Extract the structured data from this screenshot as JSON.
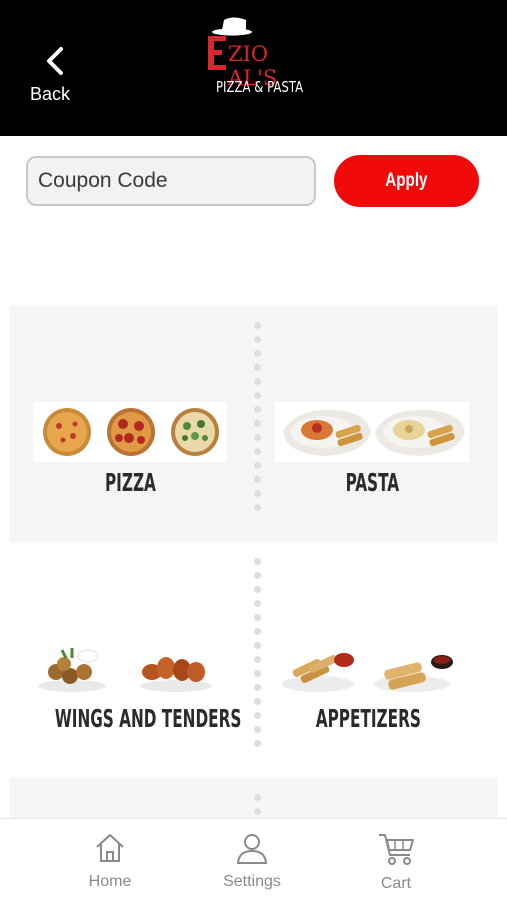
{
  "header": {
    "back_label": "Back",
    "logo": {
      "name": "ZIO AL'S",
      "initial": "E",
      "subtitle": "PIZZA & PASTA"
    }
  },
  "coupon": {
    "placeholder": "Coupon Code",
    "value": "",
    "apply_label": "Apply"
  },
  "categories": [
    {
      "label": "PIZZA"
    },
    {
      "label": "PASTA"
    },
    {
      "label": "WINGS AND TENDERS"
    },
    {
      "label": "APPETIZERS"
    }
  ],
  "bottom_nav": {
    "items": [
      {
        "label": "Home",
        "icon": "home-icon"
      },
      {
        "label": "Settings",
        "icon": "user-icon"
      },
      {
        "label": "Cart",
        "icon": "cart-icon"
      }
    ]
  },
  "colors": {
    "header_bg": "#000000",
    "accent": "#f00a0a",
    "logo_red": "#d8262c"
  }
}
